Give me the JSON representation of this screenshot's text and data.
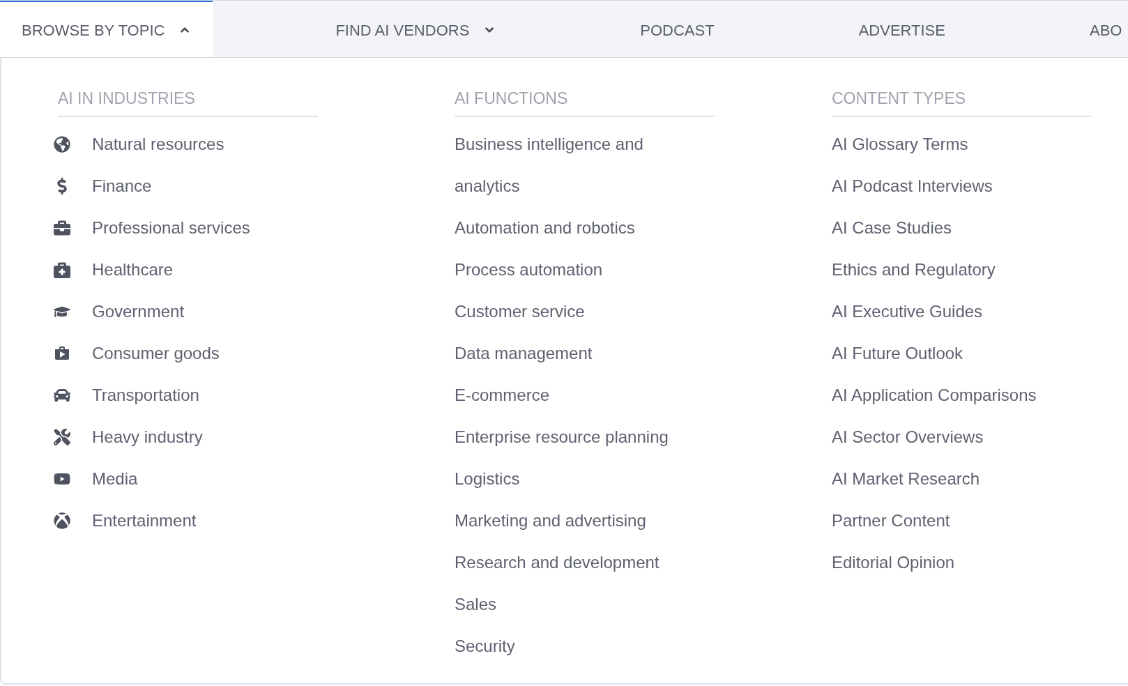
{
  "nav": {
    "items": [
      {
        "label": "BROWSE BY TOPIC",
        "kind": "dropdown",
        "expanded": true,
        "selected": true
      },
      {
        "label": "FIND AI VENDORS",
        "kind": "dropdown",
        "expanded": false,
        "selected": false
      },
      {
        "label": "PODCAST",
        "kind": "link",
        "selected": false
      },
      {
        "label": "ADVERTISE",
        "kind": "link",
        "selected": false
      },
      {
        "label": "ABO",
        "kind": "link",
        "selected": false
      }
    ]
  },
  "dropdown_panel": {
    "columns": [
      {
        "heading": "AI IN INDUSTRIES",
        "kind": "icon_list",
        "items": [
          "Natural resources",
          "Finance",
          "Professional services",
          "Healthcare",
          "Government",
          "Consumer goods",
          "Transportation",
          "Heavy industry",
          "Media",
          "Entertainment"
        ]
      },
      {
        "heading": "AI FUNCTIONS",
        "kind": "plain_list",
        "items": [
          "Business intelligence and analytics",
          "Automation and robotics",
          "Process automation",
          "Customer service",
          "Data management",
          "E-commerce",
          "Enterprise resource planning",
          "Logistics",
          "Marketing and advertising",
          "Research and development",
          "Sales",
          "Security"
        ]
      },
      {
        "heading": "CONTENT TYPES",
        "kind": "plain_list",
        "items": [
          "AI Glossary Terms",
          "AI Podcast Interviews",
          "AI Case Studies",
          "Ethics and Regulatory",
          "AI Executive Guides",
          "AI Future Outlook",
          "AI Application Comparisons",
          "AI Sector Overviews",
          "AI Market Research",
          "Partner Content",
          "Editorial Opinion"
        ]
      }
    ]
  }
}
